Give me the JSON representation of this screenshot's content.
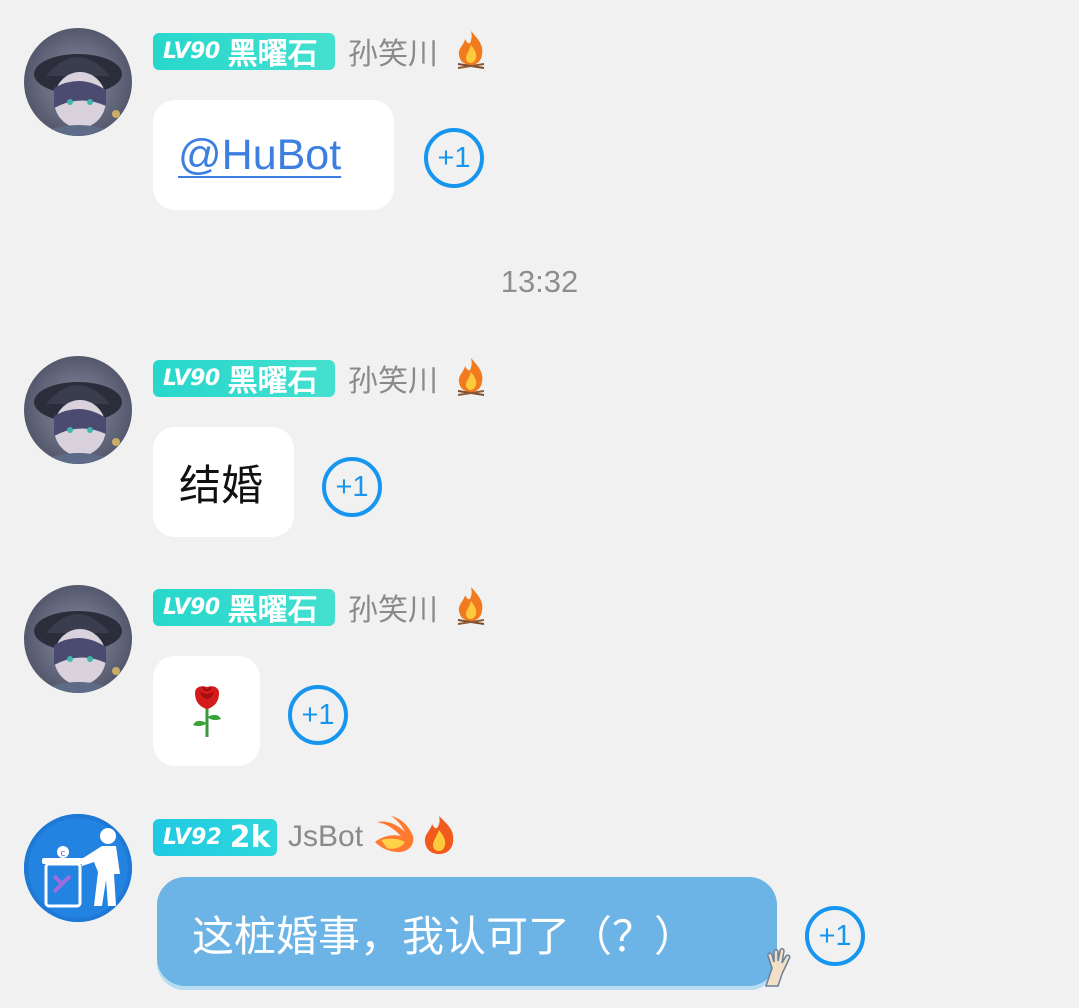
{
  "messages": [
    {
      "level": "LV90",
      "rank": "黑曜石",
      "nickname": "孙笑川",
      "content": "@HuBot",
      "plus_one": "+1"
    },
    {
      "level": "LV90",
      "rank": "黑曜石",
      "nickname": "孙笑川",
      "content": "结婚",
      "plus_one": "+1"
    },
    {
      "level": "LV90",
      "rank": "黑曜石",
      "nickname": "孙笑川",
      "content": "🌹",
      "plus_one": "+1"
    },
    {
      "level": "LV92",
      "rank": "2k",
      "nickname": "JsBot",
      "content": "这桩婚事，我认可了（？）",
      "plus_one": "+1"
    }
  ],
  "timestamp": "13:32",
  "colors": {
    "background": "#f1f1f1",
    "badge": "#27d7cc",
    "plus_one": "#1696ee",
    "mention": "#3d7fe0",
    "bot_bubble": "#6db4e6"
  },
  "icons": {
    "flame": "flame-icon",
    "wing_flame": "winged-flame-icon",
    "bot_avatar": "trash-bin-avatar"
  }
}
